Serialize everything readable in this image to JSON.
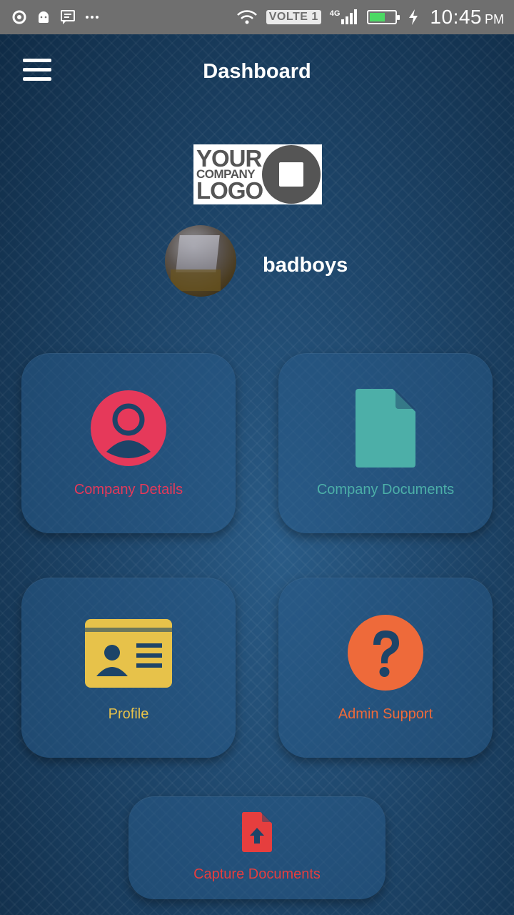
{
  "status_bar": {
    "left_icons": [
      "sync-icon",
      "android-icon",
      "message-icon",
      "more-dots-icon"
    ],
    "volte": "VOLTE 1",
    "network": "4G",
    "battery_level": 0.6,
    "time": "10:45",
    "ampm": "PM"
  },
  "appbar": {
    "title": "Dashboard"
  },
  "logo": {
    "line1": "YOUR",
    "line2": "COMPANY",
    "line3": "LOGO"
  },
  "user": {
    "name": "badboys"
  },
  "tiles": [
    {
      "label": "Company Details",
      "icon": "user-circle-icon",
      "color": "#e6395a"
    },
    {
      "label": "Company Documents",
      "icon": "document-icon",
      "color": "#4cafa8"
    },
    {
      "label": "Profile",
      "icon": "id-card-icon",
      "color": "#e7c24a"
    },
    {
      "label": "Admin Support",
      "icon": "question-circle-icon",
      "color": "#ee6a3a"
    },
    {
      "label": "Capture Documents",
      "icon": "file-upload-icon",
      "color": "#e63e3e"
    }
  ]
}
